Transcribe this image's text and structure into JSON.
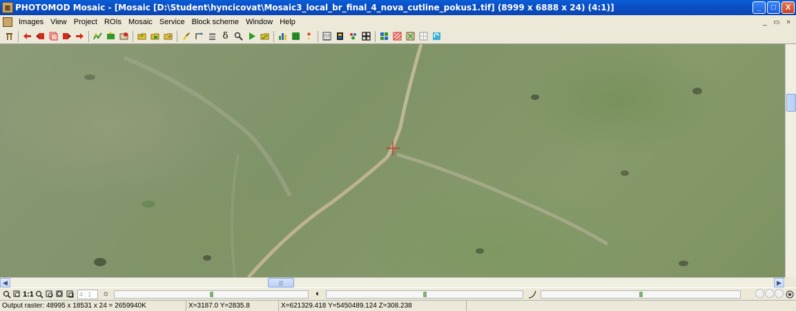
{
  "window": {
    "title": "PHOTOMOD Mosaic - [Mosaic [D:\\Student\\hyncicovat\\Mosaic3_local_br_final_4_nova_cutline_pokus1.tif] (8999 x 6888 x 24) (4:1)]",
    "buttons": {
      "minimize": "_",
      "maximize": "□",
      "close": "X"
    }
  },
  "menu": {
    "items": [
      "Images",
      "View",
      "Project",
      "ROIs",
      "Mosaic",
      "Service",
      "Block scheme",
      "Window",
      "Help"
    ],
    "mdi_buttons": [
      "_",
      "▭",
      "×"
    ]
  },
  "toolbar": {
    "icons": [
      "tower-icon",
      "arrow-left-icon",
      "stack-left-icon",
      "layers-icon",
      "layers-right-icon",
      "arrow-right-icon",
      "cutline-icon",
      "roi-edit-icon",
      "roi-add-icon",
      "folder-open-icon",
      "folder-save-icon",
      "folder-export-icon",
      "brush-icon",
      "line-tool-icon",
      "rotate-icon",
      "delta-icon",
      "magnifier-icon",
      "play-icon",
      "open-image-icon",
      "histogram-icon",
      "grid-icon",
      "star-icon",
      "binary-icon",
      "film-icon",
      "palette-icon",
      "tiles-icon",
      "mosaic-icon",
      "hatch-icon",
      "crop-icon",
      "blank-grid-icon",
      "refresh-icon"
    ],
    "accent_colors": {
      "red": "#d42a1e",
      "green": "#2f9a2c",
      "blue": "#2b66c8",
      "yellow": "#e6c227"
    }
  },
  "viewport": {
    "crosshair_color": "#e02020"
  },
  "controls": {
    "ratio_label": "1:1",
    "zoom_value": "4 : 1",
    "sliders": [
      {
        "name": "brightness",
        "level": 0.5
      },
      {
        "name": "contrast",
        "level": 0.5
      },
      {
        "name": "gamma",
        "level": 0.5
      }
    ]
  },
  "status": {
    "output_raster": "Output raster: 48995 x 18531 x 24 = 2659940K",
    "pixel_coords": "X=3187.0 Y=2835.8",
    "world_coords": "X=621329.418 Y=5450489.124 Z=308.238"
  }
}
